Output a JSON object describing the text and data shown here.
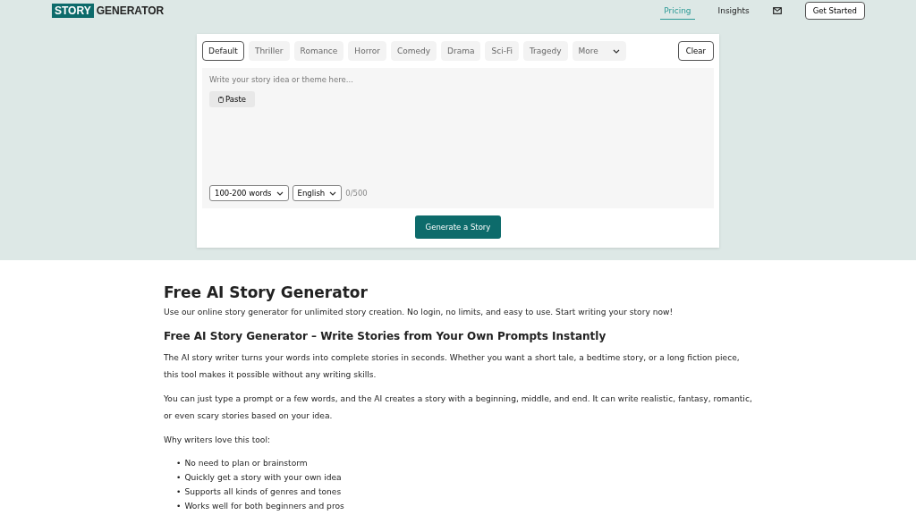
{
  "header": {
    "logo_badge": "STORY",
    "logo_text": "GENERATOR",
    "nav": [
      {
        "label": "Pricing",
        "selected": true
      },
      {
        "label": "Insights",
        "selected": false
      }
    ],
    "cta": "Get Started"
  },
  "generator": {
    "genres": [
      {
        "label": "Default",
        "selected": true
      },
      {
        "label": "Thriller",
        "selected": false
      },
      {
        "label": "Romance",
        "selected": false
      },
      {
        "label": "Horror",
        "selected": false
      },
      {
        "label": "Comedy",
        "selected": false
      },
      {
        "label": "Drama",
        "selected": false
      },
      {
        "label": "Sci-Fi",
        "selected": false
      },
      {
        "label": "Tragedy",
        "selected": false
      }
    ],
    "more": "More",
    "clear": "Clear",
    "placeholder": "Write your story idea or theme here...",
    "paste": "Paste",
    "length": "100-200 words",
    "language": "English",
    "counter": "0/500",
    "generate": "Generate a Story"
  },
  "article": {
    "title": "Free AI Story Generator",
    "intro": "Use our online story generator for unlimited story creation. No login, no limits, and easy to use. Start writing your story now!",
    "subtitle": "Free AI Story Generator – Write Stories from Your Own Prompts Instantly",
    "paragraphs": [
      "The AI story writer turns your words into complete stories in seconds. Whether you want a short tale, a bedtime story, or a long fiction piece, this tool makes it possible without any writing skills.",
      "You can just type a prompt or a few words, and the AI creates a story with a beginning, middle, and end. It can write realistic, fantasy, romantic, or even scary stories based on your idea.",
      "Why writers love this tool:"
    ],
    "bullets": [
      {
        "marker": "•",
        "text": "No need to plan or brainstorm"
      },
      {
        "marker": "•",
        "text": "Quickly get a story with your own idea"
      },
      {
        "marker": "•",
        "text": "Supports all kinds of genres and tones"
      },
      {
        "marker": "•",
        "text": "Works well for both beginners and pros"
      }
    ]
  }
}
